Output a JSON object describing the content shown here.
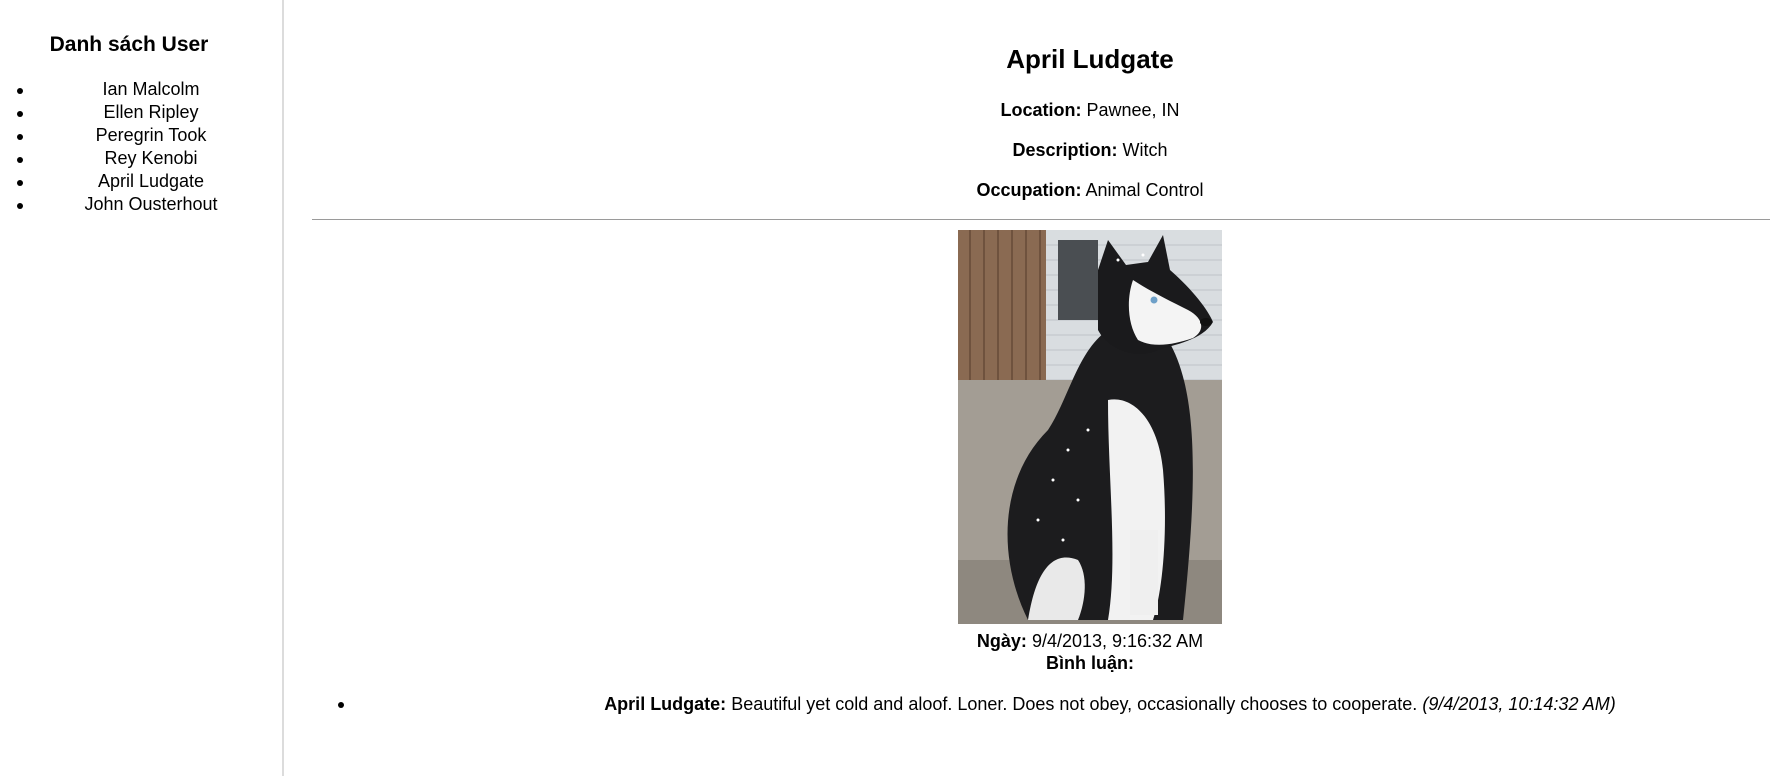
{
  "sidebar": {
    "title": "Danh sách User",
    "users": [
      "Ian Malcolm",
      "Ellen Ripley",
      "Peregrin Took",
      "Rey Kenobi",
      "April Ludgate",
      "John Ousterhout"
    ]
  },
  "user": {
    "name": "April Ludgate",
    "location_label": "Location:",
    "location": "Pawnee, IN",
    "description_label": "Description:",
    "description": "Witch",
    "occupation_label": "Occupation:",
    "occupation": "Animal Control"
  },
  "photo": {
    "date_label": "Ngày:",
    "date": "9/4/2013, 9:16:32 AM",
    "comments_label": "Bình luận:",
    "comments": [
      {
        "author": "April Ludgate:",
        "text": "Beautiful yet cold and aloof. Loner. Does not obey, occasionally chooses to cooperate.",
        "date": "(9/4/2013, 10:14:32 AM)"
      }
    ]
  }
}
